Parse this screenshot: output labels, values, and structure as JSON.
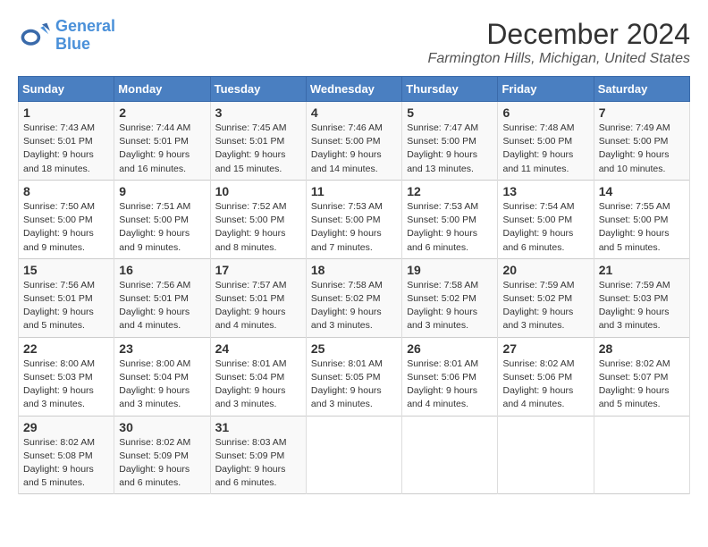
{
  "header": {
    "logo_line1": "General",
    "logo_line2": "Blue",
    "month": "December 2024",
    "location": "Farmington Hills, Michigan, United States"
  },
  "days_of_week": [
    "Sunday",
    "Monday",
    "Tuesday",
    "Wednesday",
    "Thursday",
    "Friday",
    "Saturday"
  ],
  "weeks": [
    [
      {
        "day": "1",
        "sunrise": "7:43 AM",
        "sunset": "5:01 PM",
        "daylight": "9 hours and 18 minutes."
      },
      {
        "day": "2",
        "sunrise": "7:44 AM",
        "sunset": "5:01 PM",
        "daylight": "9 hours and 16 minutes."
      },
      {
        "day": "3",
        "sunrise": "7:45 AM",
        "sunset": "5:01 PM",
        "daylight": "9 hours and 15 minutes."
      },
      {
        "day": "4",
        "sunrise": "7:46 AM",
        "sunset": "5:00 PM",
        "daylight": "9 hours and 14 minutes."
      },
      {
        "day": "5",
        "sunrise": "7:47 AM",
        "sunset": "5:00 PM",
        "daylight": "9 hours and 13 minutes."
      },
      {
        "day": "6",
        "sunrise": "7:48 AM",
        "sunset": "5:00 PM",
        "daylight": "9 hours and 11 minutes."
      },
      {
        "day": "7",
        "sunrise": "7:49 AM",
        "sunset": "5:00 PM",
        "daylight": "9 hours and 10 minutes."
      }
    ],
    [
      {
        "day": "8",
        "sunrise": "7:50 AM",
        "sunset": "5:00 PM",
        "daylight": "9 hours and 9 minutes."
      },
      {
        "day": "9",
        "sunrise": "7:51 AM",
        "sunset": "5:00 PM",
        "daylight": "9 hours and 9 minutes."
      },
      {
        "day": "10",
        "sunrise": "7:52 AM",
        "sunset": "5:00 PM",
        "daylight": "9 hours and 8 minutes."
      },
      {
        "day": "11",
        "sunrise": "7:53 AM",
        "sunset": "5:00 PM",
        "daylight": "9 hours and 7 minutes."
      },
      {
        "day": "12",
        "sunrise": "7:53 AM",
        "sunset": "5:00 PM",
        "daylight": "9 hours and 6 minutes."
      },
      {
        "day": "13",
        "sunrise": "7:54 AM",
        "sunset": "5:00 PM",
        "daylight": "9 hours and 6 minutes."
      },
      {
        "day": "14",
        "sunrise": "7:55 AM",
        "sunset": "5:00 PM",
        "daylight": "9 hours and 5 minutes."
      }
    ],
    [
      {
        "day": "15",
        "sunrise": "7:56 AM",
        "sunset": "5:01 PM",
        "daylight": "9 hours and 5 minutes."
      },
      {
        "day": "16",
        "sunrise": "7:56 AM",
        "sunset": "5:01 PM",
        "daylight": "9 hours and 4 minutes."
      },
      {
        "day": "17",
        "sunrise": "7:57 AM",
        "sunset": "5:01 PM",
        "daylight": "9 hours and 4 minutes."
      },
      {
        "day": "18",
        "sunrise": "7:58 AM",
        "sunset": "5:02 PM",
        "daylight": "9 hours and 3 minutes."
      },
      {
        "day": "19",
        "sunrise": "7:58 AM",
        "sunset": "5:02 PM",
        "daylight": "9 hours and 3 minutes."
      },
      {
        "day": "20",
        "sunrise": "7:59 AM",
        "sunset": "5:02 PM",
        "daylight": "9 hours and 3 minutes."
      },
      {
        "day": "21",
        "sunrise": "7:59 AM",
        "sunset": "5:03 PM",
        "daylight": "9 hours and 3 minutes."
      }
    ],
    [
      {
        "day": "22",
        "sunrise": "8:00 AM",
        "sunset": "5:03 PM",
        "daylight": "9 hours and 3 minutes."
      },
      {
        "day": "23",
        "sunrise": "8:00 AM",
        "sunset": "5:04 PM",
        "daylight": "9 hours and 3 minutes."
      },
      {
        "day": "24",
        "sunrise": "8:01 AM",
        "sunset": "5:04 PM",
        "daylight": "9 hours and 3 minutes."
      },
      {
        "day": "25",
        "sunrise": "8:01 AM",
        "sunset": "5:05 PM",
        "daylight": "9 hours and 3 minutes."
      },
      {
        "day": "26",
        "sunrise": "8:01 AM",
        "sunset": "5:06 PM",
        "daylight": "9 hours and 4 minutes."
      },
      {
        "day": "27",
        "sunrise": "8:02 AM",
        "sunset": "5:06 PM",
        "daylight": "9 hours and 4 minutes."
      },
      {
        "day": "28",
        "sunrise": "8:02 AM",
        "sunset": "5:07 PM",
        "daylight": "9 hours and 5 minutes."
      }
    ],
    [
      {
        "day": "29",
        "sunrise": "8:02 AM",
        "sunset": "5:08 PM",
        "daylight": "9 hours and 5 minutes."
      },
      {
        "day": "30",
        "sunrise": "8:02 AM",
        "sunset": "5:09 PM",
        "daylight": "9 hours and 6 minutes."
      },
      {
        "day": "31",
        "sunrise": "8:03 AM",
        "sunset": "5:09 PM",
        "daylight": "9 hours and 6 minutes."
      },
      null,
      null,
      null,
      null
    ]
  ]
}
